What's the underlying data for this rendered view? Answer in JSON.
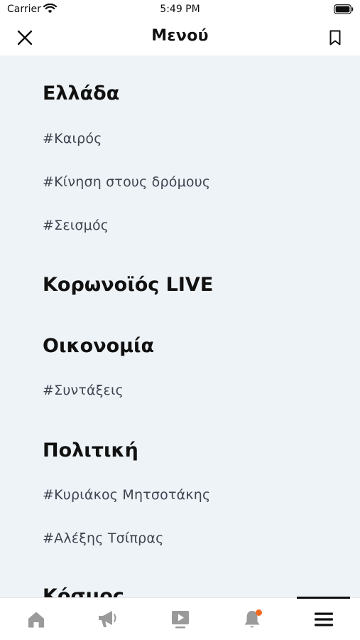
{
  "status_bar": {
    "carrier": "Carrier",
    "time": "5:49 PM"
  },
  "nav": {
    "title": "Μενού"
  },
  "menu": {
    "greece": {
      "heading": "Ελλάδα",
      "tags": [
        "#Καιρός",
        "#Κίνηση στους δρόμους",
        "#Σεισμός"
      ]
    },
    "corona": {
      "heading": "Κορωνοϊός LIVE"
    },
    "economy": {
      "heading": "Οικονομία",
      "tags": [
        "#Συντάξεις"
      ]
    },
    "politics": {
      "heading": "Πολιτική",
      "tags": [
        "#Κυριάκος Μητσοτάκης",
        "#Αλέξης Τσίπρας"
      ]
    },
    "world": {
      "heading": "Κόσμος"
    }
  },
  "tab_bar": {
    "tabs": [
      {
        "icon": "home-icon"
      },
      {
        "icon": "megaphone-icon"
      },
      {
        "icon": "video-icon"
      },
      {
        "icon": "bell-icon",
        "has_notification": true
      },
      {
        "icon": "menu-icon",
        "selected": true
      }
    ],
    "notification_color": "#f26a21"
  }
}
